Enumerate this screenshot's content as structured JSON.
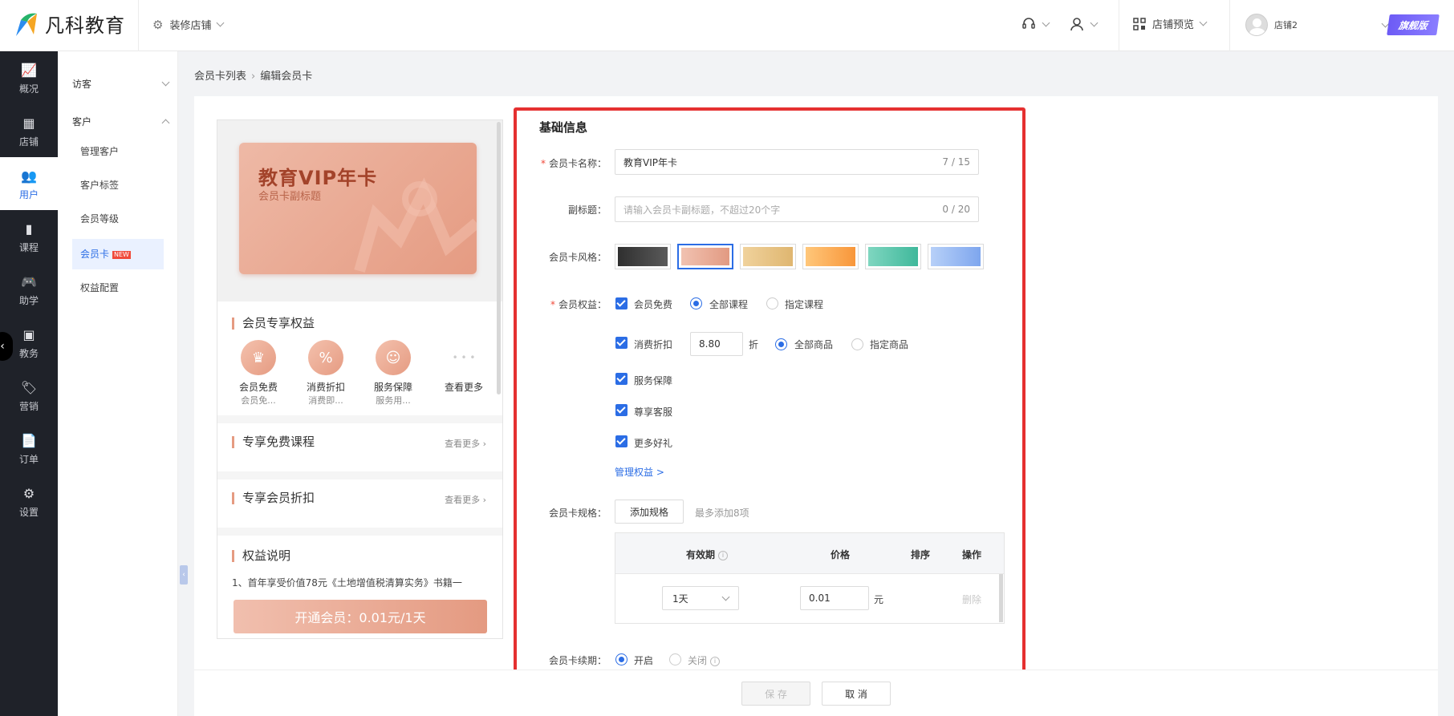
{
  "header": {
    "brand": "凡科教育",
    "store_select": "装修店铺",
    "store_preview": "店铺预览",
    "user_name": "店铺2",
    "edition_badge": "旗舰版",
    "icons": [
      "headset-icon",
      "user-icon",
      "qrcode-icon"
    ]
  },
  "leftnav": [
    {
      "label": "概况",
      "icon": "chart-icon"
    },
    {
      "label": "店铺",
      "icon": "store-icon"
    },
    {
      "label": "用户",
      "icon": "users-icon",
      "active": true
    },
    {
      "label": "课程",
      "icon": "book-icon"
    },
    {
      "label": "助学",
      "icon": "gamepad-icon"
    },
    {
      "label": "教务",
      "icon": "calendar-icon"
    },
    {
      "label": "营销",
      "icon": "tag-icon"
    },
    {
      "label": "订单",
      "icon": "order-icon"
    },
    {
      "label": "设置",
      "icon": "gear-icon"
    }
  ],
  "subnav": {
    "group1": "访客",
    "group2": "客户",
    "items": [
      "管理客户",
      "客户标签",
      "会员等级",
      "会员卡",
      "权益配置"
    ],
    "new_tag": "NEW"
  },
  "breadcrumb": {
    "parent": "会员卡列表",
    "current": "编辑会员卡"
  },
  "preview": {
    "card_title": "教育VIP年卡",
    "card_subtitle": "会员卡副标题",
    "benefits_title": "会员专享权益",
    "benefits": [
      {
        "name": "会员免费",
        "desc": "会员免..."
      },
      {
        "name": "消费折扣",
        "desc": "消费即..."
      },
      {
        "name": "服务保障",
        "desc": "服务用..."
      }
    ],
    "benefits_more": "查看更多",
    "courses_title": "专享免费课程",
    "discount_title": "专享会员折扣",
    "more_link": "查看更多",
    "rights_title": "权益说明",
    "rights_text": "1、首年享受价值78元《土地增值税清算实务》书籍一",
    "open_button": "开通会员：0.01元/1天"
  },
  "form": {
    "section_title": "基础信息",
    "name_label": "会员卡名称：",
    "name_value": "教育VIP年卡",
    "name_count": "7 / 15",
    "subtitle_label": "副标题：",
    "subtitle_placeholder": "请输入会员卡副标题，不超过20个字",
    "subtitle_count": "0 / 20",
    "style_label": "会员卡风格：",
    "style_colors": [
      {
        "from": "#2f2f2f",
        "to": "#5a5a5a"
      },
      {
        "from": "#f1c2b1",
        "to": "#e29a82"
      },
      {
        "from": "#f0d29c",
        "to": "#dfb670"
      },
      {
        "from": "#ffc77a",
        "to": "#f8963a"
      },
      {
        "from": "#7fd6c0",
        "to": "#3fb89b"
      },
      {
        "from": "#b7d0f8",
        "to": "#7ea6ee"
      }
    ],
    "rights_label": "会员权益：",
    "right_free": "会员免费",
    "all_courses": "全部课程",
    "specified_courses": "指定课程",
    "right_discount": "消费折扣",
    "discount_value": "8.80",
    "discount_unit": "折",
    "all_goods": "全部商品",
    "specified_goods": "指定商品",
    "right_service": "服务保障",
    "right_vip_service": "尊享客服",
    "right_gifts": "更多好礼",
    "manage_rights": "管理权益 >",
    "spec_label": "会员卡规格：",
    "add_spec": "添加规格",
    "spec_hint": "最多添加8项",
    "table_headers": [
      "有效期",
      "价格",
      "排序",
      "操作"
    ],
    "row_period": "1天",
    "row_price": "0.01",
    "row_price_unit": "元",
    "row_delete": "删除",
    "renew_label": "会员卡续期：",
    "renew_on": "开启",
    "renew_off": "关闭"
  },
  "footer": {
    "save": "保 存",
    "cancel": "取 消"
  }
}
